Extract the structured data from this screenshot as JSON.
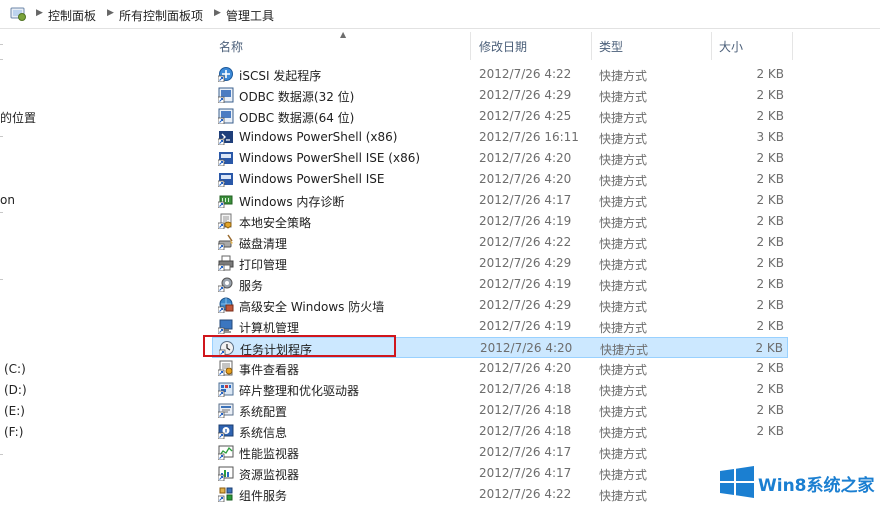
{
  "address_bar": {
    "crumbs": [
      "控制面板",
      "所有控制面板项",
      "管理工具"
    ]
  },
  "nav_pane": {
    "items": [
      "的位置",
      "on",
      "(C:)",
      "(D:)",
      "(E:)",
      "(F:)"
    ]
  },
  "columns": {
    "name": "名称",
    "date": "修改日期",
    "type": "类型",
    "size": "大小"
  },
  "files": [
    {
      "name": "iSCSI 发起程序",
      "date": "2012/7/26 4:22",
      "type": "快捷方式",
      "size": "2 KB",
      "icon": "iscsi-icon"
    },
    {
      "name": "ODBC 数据源(32 位)",
      "date": "2012/7/26 4:29",
      "type": "快捷方式",
      "size": "2 KB",
      "icon": "odbc-icon"
    },
    {
      "name": "ODBC 数据源(64 位)",
      "date": "2012/7/26 4:25",
      "type": "快捷方式",
      "size": "2 KB",
      "icon": "odbc-icon"
    },
    {
      "name": "Windows PowerShell (x86)",
      "date": "2012/7/26 16:11",
      "type": "快捷方式",
      "size": "3 KB",
      "icon": "powershell-icon"
    },
    {
      "name": "Windows PowerShell ISE (x86)",
      "date": "2012/7/26 4:20",
      "type": "快捷方式",
      "size": "2 KB",
      "icon": "powershell-ise-icon"
    },
    {
      "name": "Windows PowerShell ISE",
      "date": "2012/7/26 4:20",
      "type": "快捷方式",
      "size": "2 KB",
      "icon": "powershell-ise-icon"
    },
    {
      "name": "Windows 内存诊断",
      "date": "2012/7/26 4:17",
      "type": "快捷方式",
      "size": "2 KB",
      "icon": "memory-diagnostic-icon"
    },
    {
      "name": "本地安全策略",
      "date": "2012/7/26 4:19",
      "type": "快捷方式",
      "size": "2 KB",
      "icon": "security-policy-icon"
    },
    {
      "name": "磁盘清理",
      "date": "2012/7/26 4:22",
      "type": "快捷方式",
      "size": "2 KB",
      "icon": "disk-cleanup-icon"
    },
    {
      "name": "打印管理",
      "date": "2012/7/26 4:29",
      "type": "快捷方式",
      "size": "2 KB",
      "icon": "printer-icon"
    },
    {
      "name": "服务",
      "date": "2012/7/26 4:19",
      "type": "快捷方式",
      "size": "2 KB",
      "icon": "services-gear-icon"
    },
    {
      "name": "高级安全 Windows 防火墙",
      "date": "2012/7/26 4:29",
      "type": "快捷方式",
      "size": "2 KB",
      "icon": "firewall-icon"
    },
    {
      "name": "计算机管理",
      "date": "2012/7/26 4:19",
      "type": "快捷方式",
      "size": "2 KB",
      "icon": "computer-management-icon"
    },
    {
      "name": "任务计划程序",
      "date": "2012/7/26 4:20",
      "type": "快捷方式",
      "size": "2 KB",
      "icon": "task-scheduler-icon",
      "selected": true
    },
    {
      "name": "事件查看器",
      "date": "2012/7/26 4:20",
      "type": "快捷方式",
      "size": "2 KB",
      "icon": "event-viewer-icon"
    },
    {
      "name": "碎片整理和优化驱动器",
      "date": "2012/7/26 4:18",
      "type": "快捷方式",
      "size": "2 KB",
      "icon": "defrag-icon"
    },
    {
      "name": "系统配置",
      "date": "2012/7/26 4:18",
      "type": "快捷方式",
      "size": "2 KB",
      "icon": "system-config-icon"
    },
    {
      "name": "系统信息",
      "date": "2012/7/26 4:18",
      "type": "快捷方式",
      "size": "2 KB",
      "icon": "system-info-icon"
    },
    {
      "name": "性能监视器",
      "date": "2012/7/26 4:17",
      "type": "快捷方式",
      "size": "",
      "icon": "performance-monitor-icon"
    },
    {
      "name": "资源监视器",
      "date": "2012/7/26 4:17",
      "type": "快捷方式",
      "size": "",
      "icon": "resource-monitor-icon"
    },
    {
      "name": "组件服务",
      "date": "2012/7/26 4:22",
      "type": "快捷方式",
      "size": "",
      "icon": "component-services-icon"
    }
  ],
  "watermark": {
    "text": "Win8系统之家"
  },
  "colors": {
    "selection_bg": "#cce8ff",
    "selection_border": "#99d1ff",
    "highlight_box": "#d0161c",
    "header_text": "#4c607a",
    "watermark_blue": "#1b7fd1"
  }
}
